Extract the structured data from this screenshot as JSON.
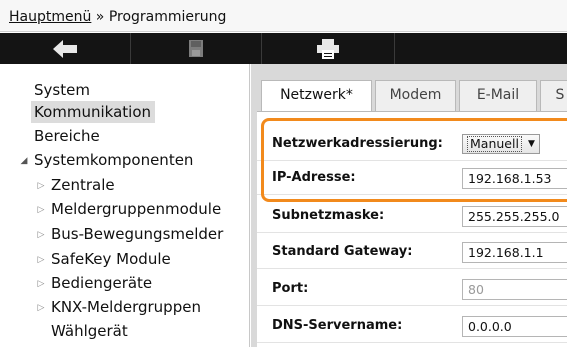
{
  "breadcrumb": {
    "root": "Hauptmenü",
    "separator": " » ",
    "current": "Programmierung"
  },
  "toolbar": {
    "icons": [
      "back-arrow-icon",
      "save-disk-icon",
      "print-icon"
    ]
  },
  "sidebar": {
    "items": [
      {
        "label": "System",
        "indent": 0,
        "selected": false
      },
      {
        "label": "Kommunikation",
        "indent": 0,
        "selected": true
      },
      {
        "label": "Bereiche",
        "indent": 0,
        "selected": false
      },
      {
        "label": "Systemkomponenten",
        "indent": 0,
        "expander": "open"
      },
      {
        "label": "Zentrale",
        "indent": 1,
        "expander": "closed"
      },
      {
        "label": "Meldergruppenmodule",
        "indent": 1,
        "expander": "closed"
      },
      {
        "label": "Bus-Bewegungsmelder",
        "indent": 1,
        "expander": "closed"
      },
      {
        "label": "SafeKey Module",
        "indent": 1,
        "expander": "closed"
      },
      {
        "label": "Bediengeräte",
        "indent": 1,
        "expander": "closed"
      },
      {
        "label": "KNX-Meldergruppen",
        "indent": 1,
        "expander": "closed"
      },
      {
        "label": "Wählgerät",
        "indent": 1
      }
    ]
  },
  "tabs": [
    {
      "label": "Netzwerk*",
      "active": true
    },
    {
      "label": "Modem",
      "active": false
    },
    {
      "label": "E-Mail",
      "active": false
    },
    {
      "label": "S",
      "active": false
    }
  ],
  "form": {
    "addressing": {
      "label": "Netzwerkadressierung:",
      "value": "Manuell"
    },
    "ip": {
      "label": "IP-Adresse:",
      "value": "192.168.1.53"
    },
    "subnet": {
      "label": "Subnetzmaske:",
      "value": "255.255.255.0"
    },
    "gateway": {
      "label": "Standard Gateway:",
      "value": "192.168.1.1"
    },
    "port": {
      "label": "Port:",
      "value": "80"
    },
    "dns": {
      "label": "DNS-Servername:",
      "value": "0.0.0.0"
    }
  },
  "colors": {
    "highlight": "#f28a1c",
    "toolbar": "#141414",
    "selected": "#dcdcdc"
  }
}
